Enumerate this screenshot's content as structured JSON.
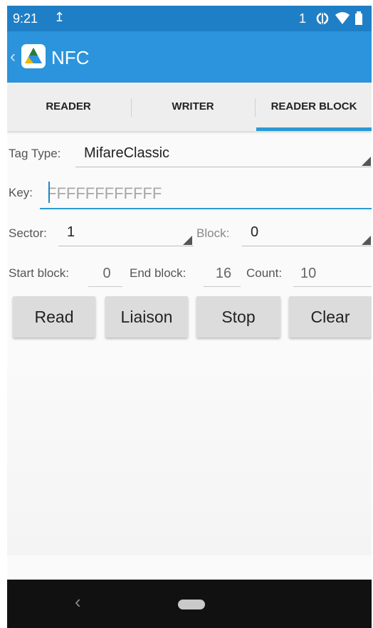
{
  "status_bar": {
    "time": "9:21",
    "upload_glyph": "↥",
    "notification_count": "1",
    "icons": [
      "upload-icon",
      "nfc-signal-icon",
      "wifi-icon",
      "battery-icon"
    ]
  },
  "app_bar": {
    "title": "NFC",
    "back_glyph": "‹",
    "logo_icon": "app-logo-icon"
  },
  "tabs": [
    {
      "label": "READER",
      "selected": false
    },
    {
      "label": "WRITER",
      "selected": false
    },
    {
      "label": "READER BLOCK",
      "selected": true
    }
  ],
  "form": {
    "tag_type_label": "Tag Type:",
    "tag_type_value": "MifareClassic",
    "key_label": "Key:",
    "key_placeholder": "FFFFFFFFFFFF",
    "sector_label": "Sector:",
    "sector_value": "1",
    "block_label": "Block:",
    "block_value": "0",
    "start_block_label": "Start block:",
    "start_block_value": "0",
    "end_block_label": "End block:",
    "end_block_value": "16",
    "count_label": "Count:",
    "count_value": "10"
  },
  "buttons": {
    "read": "Read",
    "liaison": "Liaison",
    "stop": "Stop",
    "clear": "Clear"
  },
  "nav_bar": {
    "back_glyph": "‹"
  },
  "colors": {
    "status_bar": "#1f7fc6",
    "app_bar": "#2b94dc",
    "accent": "#2b9ad6",
    "button": "#dcdcdc",
    "nav_bar": "#111111"
  }
}
